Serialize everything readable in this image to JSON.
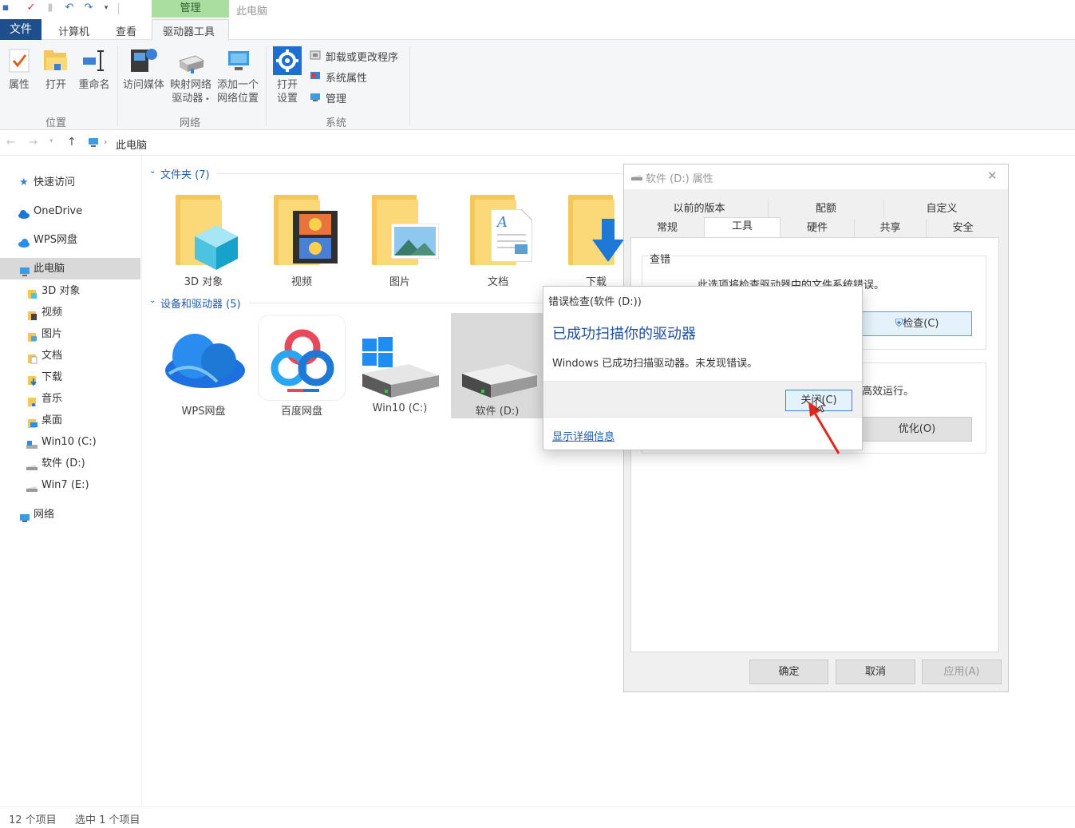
{
  "title_bar": {
    "context_tab": "管理",
    "window_title": "此电脑",
    "qat_icons": [
      "folder-icon",
      "properties-icon",
      "new-folder-icon",
      "undo-icon",
      "redo-icon",
      "customize-qat-icon"
    ]
  },
  "ribbon_tabs": {
    "file": "文件",
    "computer": "计算机",
    "view": "查看",
    "drive_tools": "驱动器工具"
  },
  "ribbon": {
    "location_group": "位置",
    "network_group": "网络",
    "system_group": "系统",
    "properties": "属性",
    "open": "打开",
    "rename": "重命名",
    "access_media": "访问媒体",
    "map_drive_1": "映射网络",
    "map_drive_2": "驱动器",
    "add_location_1": "添加一个",
    "add_location_2": "网络位置",
    "open_settings_1": "打开",
    "open_settings_2": "设置",
    "uninstall": "卸载或更改程序",
    "system_props": "系统属性",
    "manage": "管理"
  },
  "address": {
    "path": "此电脑"
  },
  "nav": {
    "quick_access": "快速访问",
    "onedrive": "OneDrive",
    "wps": "WPS网盘",
    "this_pc": "此电脑",
    "objects3d": "3D 对象",
    "videos": "视频",
    "pictures": "图片",
    "documents": "文档",
    "downloads": "下载",
    "music": "音乐",
    "desktop": "桌面",
    "win10": "Win10 (C:)",
    "soft": "软件 (D:)",
    "win7": "Win7 (E:)",
    "network": "网络"
  },
  "content": {
    "folders_header": "文件夹 (7)",
    "devices_header": "设备和驱动器 (5)",
    "folders": [
      "3D 对象",
      "视频",
      "图片",
      "文档",
      "下载"
    ],
    "devices": [
      "WPS网盘",
      "百度网盘",
      "Win10 (C:)",
      "软件 (D:)"
    ]
  },
  "status": {
    "count": "12 个项目",
    "selected": "选中 1 个项目"
  },
  "properties_dialog": {
    "title": "软件 (D:) 属性",
    "tabs_row1": [
      "以前的版本",
      "配额",
      "自定义"
    ],
    "tabs_row2": [
      "常规",
      "工具",
      "硬件",
      "共享",
      "安全"
    ],
    "error_group": "查错",
    "error_desc": "此选项将检查驱动器中的文件系统错误。",
    "check_button": "检查(C)",
    "optimize_desc": "高效运行。",
    "optimize_button": "优化(O)",
    "ok": "确定",
    "cancel": "取消",
    "apply": "应用(A)"
  },
  "check_dialog": {
    "title": "错误检查(软件 (D:))",
    "heading": "已成功扫描你的驱动器",
    "message": "Windows 已成功扫描驱动器。未发现错误。",
    "close_button": "关闭(C)",
    "details_link": "显示详细信息"
  },
  "colors": {
    "accent": "#1f4e8c",
    "context_green": "#a9dea0",
    "link_blue": "#1e5aa8",
    "annotation_red": "#e0271f"
  }
}
